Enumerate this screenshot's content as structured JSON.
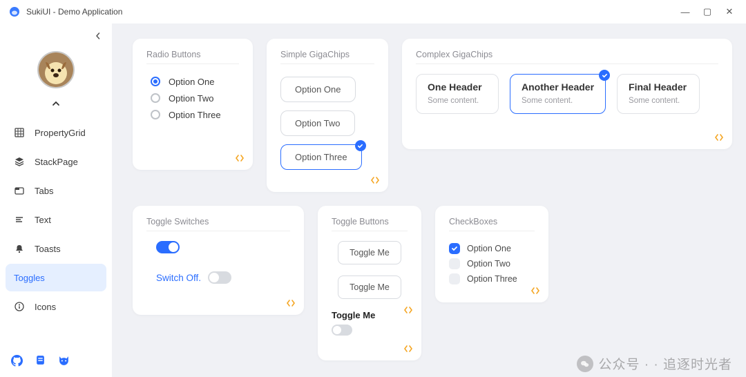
{
  "window": {
    "title": "SukiUI - Demo Application"
  },
  "sidebar": {
    "items": [
      {
        "label": "PropertyGrid"
      },
      {
        "label": "StackPage"
      },
      {
        "label": "Tabs"
      },
      {
        "label": "Text"
      },
      {
        "label": "Toasts"
      },
      {
        "label": "Toggles"
      },
      {
        "label": "Icons"
      }
    ],
    "active_index": 5
  },
  "cards": {
    "radio": {
      "title": "Radio Buttons",
      "options": [
        "Option One",
        "Option Two",
        "Option Three"
      ],
      "selected_index": 0
    },
    "simple_chips": {
      "title": "Simple GigaChips",
      "options": [
        "Option One",
        "Option Two",
        "Option Three"
      ],
      "selected_index": 2
    },
    "complex_chips": {
      "title": "Complex GigaChips",
      "items": [
        {
          "header": "One Header",
          "sub": "Some content."
        },
        {
          "header": "Another Header",
          "sub": "Some content."
        },
        {
          "header": "Final Header",
          "sub": "Some content."
        }
      ],
      "selected_index": 1
    },
    "toggle_switches": {
      "title": "Toggle Switches",
      "switch1_on": true,
      "switch2_label": "Switch Off.",
      "switch2_on": false
    },
    "toggle_buttons": {
      "title": "Toggle Buttons",
      "btn1": "Toggle Me",
      "btn2": "Toggle Me",
      "label3": "Toggle Me"
    },
    "checkboxes": {
      "title": "CheckBoxes",
      "items": [
        {
          "label": "Option One",
          "checked": true
        },
        {
          "label": "Option Two",
          "checked": false
        },
        {
          "label": "Option Three",
          "checked": false
        }
      ]
    }
  },
  "watermark": "公众号 · · 追逐时光者"
}
